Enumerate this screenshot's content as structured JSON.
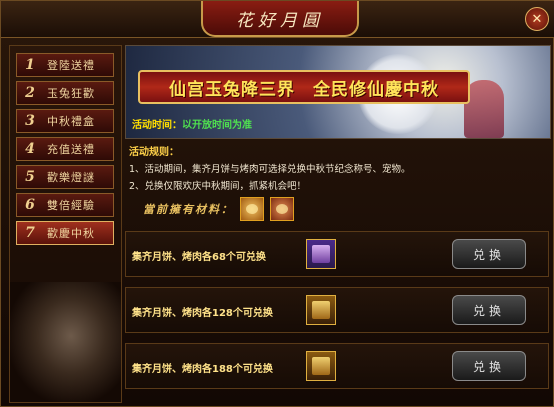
{
  "window": {
    "title": "花好月圓",
    "close_label": "✕"
  },
  "sidebar": {
    "tabs": [
      {
        "num": "1",
        "label": "登陸送禮"
      },
      {
        "num": "2",
        "label": "玉兔狂歡"
      },
      {
        "num": "3",
        "label": "中秋禮盒"
      },
      {
        "num": "4",
        "label": "充值送禮"
      },
      {
        "num": "5",
        "label": "歡樂燈謎"
      },
      {
        "num": "6",
        "label": "雙倍經驗"
      },
      {
        "num": "7",
        "label": "歡慶中秋"
      }
    ],
    "active_tab": "7"
  },
  "banner": {
    "title": "仙宫玉兔降三界　全民修仙慶中秋",
    "time_label": "活动时间：",
    "time_value": "以开放时间为准"
  },
  "rules": {
    "heading": "活动规则：",
    "lines": [
      "1、活动期间，集齐月饼与烤肉可选择兑换中秋节纪念称号、宠物。",
      "2、兑换仅限欢庆中秋期间，抓紧机会吧！"
    ]
  },
  "materials": {
    "label": "當前擁有材料：",
    "icons": [
      "mooncake-icon",
      "roast-meat-icon"
    ]
  },
  "exchanges": [
    {
      "desc": "集齐月饼、烤肉各68个可兑换",
      "button": "兑换",
      "reward_icon": "title-card-icon"
    },
    {
      "desc": "集齐月饼、烤肉各128个可兑换",
      "button": "兑换",
      "reward_icon": "pet-box-icon"
    },
    {
      "desc": "集齐月饼、烤肉各188个可兑换",
      "button": "兑换",
      "reward_icon": "pet-box-icon"
    }
  ]
}
